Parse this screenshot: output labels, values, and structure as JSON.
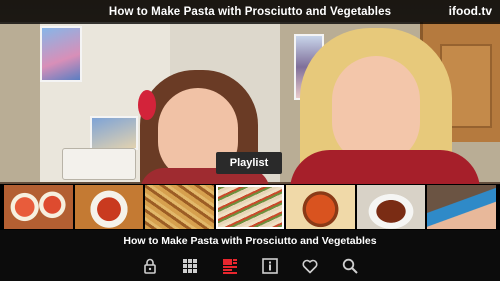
{
  "header": {
    "title": "How to Make Pasta with Prosciutto and Vegetables",
    "brand": "ifood.tv"
  },
  "playlist": {
    "label": "Playlist"
  },
  "thumbnails": [
    {
      "name": "bruschetta"
    },
    {
      "name": "tomato-sauce-pot"
    },
    {
      "name": "fried-pasta"
    },
    {
      "name": "pasta-with-vegetables"
    },
    {
      "name": "sauce-dish"
    },
    {
      "name": "soup-bowl"
    },
    {
      "name": "chef-video"
    }
  ],
  "caption": {
    "text": "How to Make Pasta with Prosciutto and Vegetables"
  },
  "toolbar": {
    "icons": [
      "lock-icon",
      "grid-icon",
      "playlist-icon",
      "info-icon",
      "heart-icon",
      "search-icon"
    ],
    "accent": "#e8262e"
  }
}
